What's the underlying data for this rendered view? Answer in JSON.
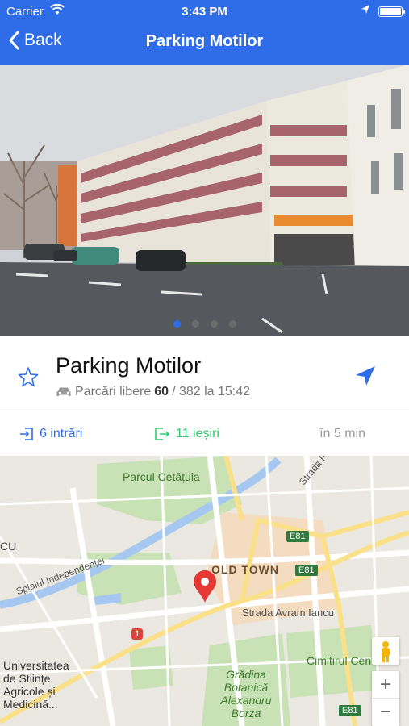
{
  "status_bar": {
    "carrier": "Carrier",
    "time": "3:43 PM"
  },
  "nav": {
    "back_label": "Back",
    "title": "Parking Motilor"
  },
  "photo": {
    "dots_count": 4,
    "active_index": 0
  },
  "parking": {
    "name": "Parking Motilor",
    "free_label": "Parcări libere",
    "free": "60",
    "total_text": "/ 382 la 15:42"
  },
  "stats": {
    "entries": "6 intrări",
    "exits": "11 ieșiri",
    "interval": "în 5 min"
  },
  "map": {
    "labels": {
      "park": "Parcul Cetățuia",
      "old_town": "OLD TOWN",
      "splai": "Splaiul Independenței",
      "avram": "Strada Avram Iancu",
      "ploi": "Strada Ploi",
      "cu": "CU",
      "univ": "Universitatea de Științe Agricole și Medicină...",
      "botanica": "Grădina Botanică Alexandru Borza",
      "cimitir": "Cimitirul Centr",
      "e81_a": "E81",
      "e81_b": "E81",
      "e81_c": "E81",
      "route1": "1"
    },
    "zoom_in": "+",
    "zoom_out": "−"
  },
  "colors": {
    "accent": "#2f6ce8",
    "exit_green": "#2ecc71",
    "pin_red": "#e53935"
  }
}
